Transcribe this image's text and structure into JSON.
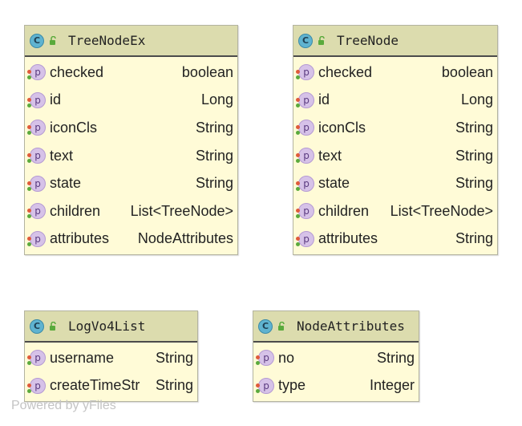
{
  "classes": [
    {
      "name": "TreeNodeEx",
      "class_icon_letter": "C",
      "field_icon_letter": "p",
      "fields": [
        {
          "name": "checked",
          "type": "boolean"
        },
        {
          "name": "id",
          "type": "Long"
        },
        {
          "name": "iconCls",
          "type": "String"
        },
        {
          "name": "text",
          "type": "String"
        },
        {
          "name": "state",
          "type": "String"
        },
        {
          "name": "children",
          "type": "List<TreeNode>"
        },
        {
          "name": "attributes",
          "type": "NodeAttributes"
        }
      ]
    },
    {
      "name": "TreeNode",
      "class_icon_letter": "C",
      "field_icon_letter": "p",
      "fields": [
        {
          "name": "checked",
          "type": "boolean"
        },
        {
          "name": "id",
          "type": "Long"
        },
        {
          "name": "iconCls",
          "type": "String"
        },
        {
          "name": "text",
          "type": "String"
        },
        {
          "name": "state",
          "type": "String"
        },
        {
          "name": "children",
          "type": "List<TreeNode>"
        },
        {
          "name": "attributes",
          "type": "String"
        }
      ]
    },
    {
      "name": "LogVo4List",
      "class_icon_letter": "C",
      "field_icon_letter": "p",
      "fields": [
        {
          "name": "username",
          "type": "String"
        },
        {
          "name": "createTimeStr",
          "type": "String"
        }
      ]
    },
    {
      "name": "NodeAttributes",
      "class_icon_letter": "C",
      "field_icon_letter": "p",
      "fields": [
        {
          "name": "no",
          "type": "String"
        },
        {
          "name": "type",
          "type": "Integer"
        }
      ]
    }
  ],
  "watermark": "Powered by yFiles",
  "colors": {
    "node_fill": "#fffbd7",
    "header_fill": "#dcdcae",
    "class_icon": "#5fb3d0",
    "field_icon": "#d6c2e8",
    "visibility_red": "#e05a3a",
    "visibility_green": "#5aaa3c"
  },
  "icons": {
    "class": "class-icon",
    "visibility": "unlock-icon",
    "field": "property-icon"
  }
}
